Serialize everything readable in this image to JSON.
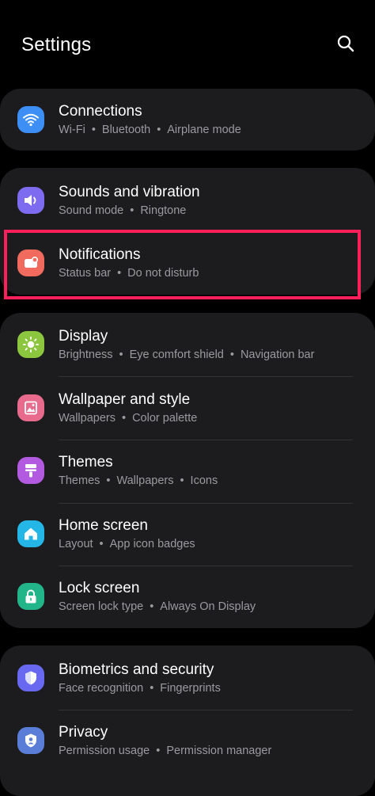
{
  "header": {
    "title": "Settings",
    "search_icon": "search-icon"
  },
  "colors": {
    "background": "#000000",
    "card": "#1c1c1e",
    "subtitle": "#9b9b9f",
    "highlight": "#ff1f5a"
  },
  "groups": [
    {
      "items": [
        {
          "title": "Connections",
          "subtitle": [
            "Wi-Fi",
            "Bluetooth",
            "Airplane mode"
          ],
          "icon": "wifi-icon",
          "icon_color": "#3d8ff5"
        }
      ]
    },
    {
      "items": [
        {
          "title": "Sounds and vibration",
          "subtitle": [
            "Sound mode",
            "Ringtone"
          ],
          "icon": "speaker-icon",
          "icon_color": "#7d6cf0"
        },
        {
          "title": "Notifications",
          "subtitle": [
            "Status bar",
            "Do not disturb"
          ],
          "icon": "notification-icon",
          "icon_color": "#f06a5e",
          "highlighted": true
        }
      ]
    },
    {
      "items": [
        {
          "title": "Display",
          "subtitle": [
            "Brightness",
            "Eye comfort shield",
            "Navigation bar"
          ],
          "icon": "sun-icon",
          "icon_color": "#8cc63f"
        },
        {
          "title": "Wallpaper and style",
          "subtitle": [
            "Wallpapers",
            "Color palette"
          ],
          "icon": "image-icon",
          "icon_color": "#e86a8c"
        },
        {
          "title": "Themes",
          "subtitle": [
            "Themes",
            "Wallpapers",
            "Icons"
          ],
          "icon": "brush-icon",
          "icon_color": "#b25ae0"
        },
        {
          "title": "Home screen",
          "subtitle": [
            "Layout",
            "App icon badges"
          ],
          "icon": "home-icon",
          "icon_color": "#25b6e8"
        },
        {
          "title": "Lock screen",
          "subtitle": [
            "Screen lock type",
            "Always On Display"
          ],
          "icon": "lock-icon",
          "icon_color": "#22b58a"
        }
      ]
    },
    {
      "items": [
        {
          "title": "Biometrics and security",
          "subtitle": [
            "Face recognition",
            "Fingerprints"
          ],
          "icon": "shield-icon",
          "icon_color": "#6868f0"
        },
        {
          "title": "Privacy",
          "subtitle": [
            "Permission usage",
            "Permission manager"
          ],
          "icon": "privacy-shield-icon",
          "icon_color": "#5a7ed8"
        }
      ]
    }
  ]
}
